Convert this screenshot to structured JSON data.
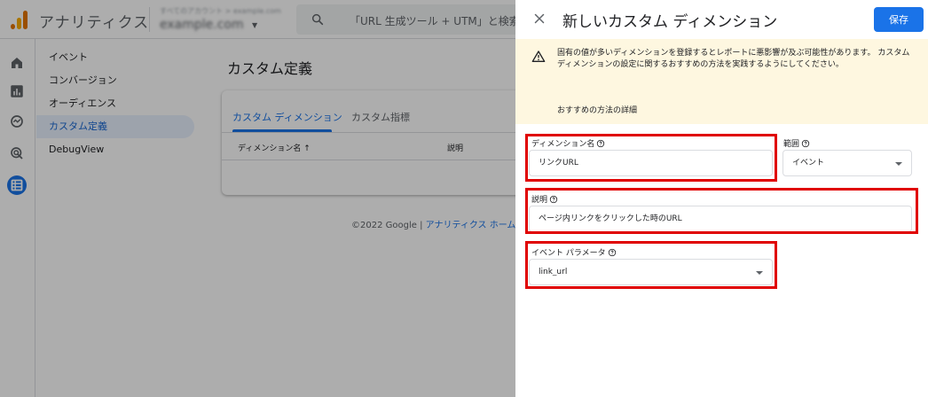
{
  "topbar": {
    "app_name": "アナリティクス",
    "account_crumb": "すべてのアカウント > example.com",
    "property_name": "example.com",
    "search_placeholder": "「URL 生成ツール + UTM」と検索して"
  },
  "sidenav": {
    "icons": [
      "home-icon",
      "reports-icon",
      "explore-icon",
      "advertising-icon",
      "configure-icon"
    ]
  },
  "subnav": {
    "items": [
      {
        "label": "イベント"
      },
      {
        "label": "コンバージョン"
      },
      {
        "label": "オーディエンス"
      },
      {
        "label": "カスタム定義"
      },
      {
        "label": "DebugView"
      }
    ],
    "selected": "カスタム定義"
  },
  "main": {
    "title": "カスタム定義",
    "tabs": [
      {
        "label": "カスタム ディメンション"
      },
      {
        "label": "カスタム指標"
      }
    ],
    "table": {
      "columns": [
        "ディメンション名 ↑",
        "説明"
      ]
    },
    "footer": {
      "copyright": "©2022 Google |",
      "link": "アナリティクス ホーム"
    }
  },
  "panel": {
    "title": "新しいカスタム ディメンション",
    "save_label": "保存",
    "warning": {
      "text": "固有の値が多いディメンションを登録するとレポートに悪影響が及ぶ可能性があります。 カスタム ディメンションの設定に関するおすすめの方法を実践するようにしてください。",
      "link": "おすすめの方法の詳細"
    },
    "fields": {
      "dimension_name": {
        "label": "ディメンション名",
        "value": "リンクURL"
      },
      "scope": {
        "label": "範囲",
        "value": "イベント"
      },
      "description": {
        "label": "説明",
        "value": "ページ内リンクをクリックした時のURL"
      },
      "event_parameter": {
        "label": "イベント パラメータ",
        "value": "link_url"
      }
    }
  },
  "colors": {
    "accent": "#1a73e8",
    "highlight": "#e00000",
    "warning_bg": "#fef7e0"
  }
}
